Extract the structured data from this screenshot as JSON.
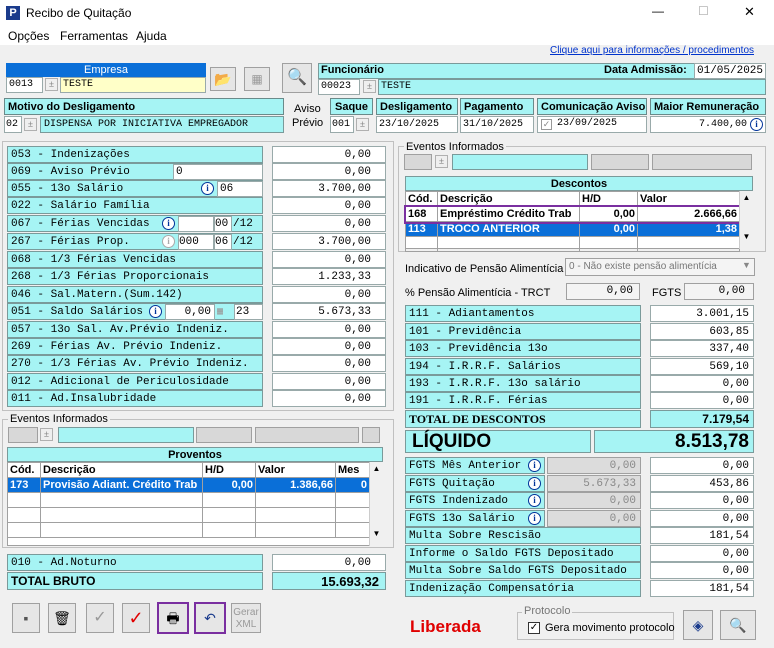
{
  "window": {
    "title": "Recibo de Quitação",
    "minimize": "—",
    "maximize": "☐",
    "close": "✕"
  },
  "menu": [
    "Opções",
    "Ferramentas",
    "Ajuda"
  ],
  "info_link": "Clique aqui para informações / procedimentos",
  "empresa": {
    "label": "Empresa",
    "code": "0013",
    "name": "TESTE"
  },
  "funcionario": {
    "label": "Funcionário",
    "code": "00023",
    "name": "TESTE",
    "admissao_label": "Data Admissão:",
    "admissao": "01/05/2025"
  },
  "motivo": {
    "label": "Motivo do Desligamento",
    "code": "02",
    "text": "DISPENSA POR INICIATIVA EMPREGADOR",
    "aviso_label_1": "Aviso",
    "aviso_label_2": "Prévio"
  },
  "saque": {
    "label": "Saque",
    "value": "001"
  },
  "desligamento": {
    "label": "Desligamento",
    "value": "23/10/2025"
  },
  "pagamento": {
    "label": "Pagamento",
    "value": "31/10/2025"
  },
  "comunicacao": {
    "label": "Comunicação Aviso",
    "value": "23/09/2025"
  },
  "maior": {
    "label": "Maior Remuneração",
    "value": "7.400,00"
  },
  "proventos_rows": [
    {
      "label": "053 - Indenizações",
      "value": "0,00"
    },
    {
      "label": "069 - Aviso Prévio",
      "extra": "0",
      "value": "0,00"
    },
    {
      "label": "055 - 13o Salário",
      "extra": "06",
      "value": "3.700,00"
    },
    {
      "label": "022 - Salário Família",
      "value": "0,00"
    },
    {
      "label": "067 - Férias Vencidas",
      "extra": "00",
      "extra2": "/12",
      "value": "0,00"
    },
    {
      "label": "267 - Férias Prop.",
      "extra": "000",
      "extra2": "06",
      "extra3": "/12",
      "value": "3.700,00"
    },
    {
      "label": "068 - 1/3 Férias Vencidas",
      "value": "0,00"
    },
    {
      "label": "268 - 1/3 Férias Proporcionais",
      "value": "1.233,33"
    },
    {
      "label": "046 - Sal.Matern.(Sum.142)",
      "value": "0,00"
    },
    {
      "label": "051 - Saldo Salários",
      "extra": "0,00",
      "extra2": "23",
      "value": "5.673,33"
    },
    {
      "label": "057 - 13o Sal. Av.Prévio Indeniz.",
      "value": "0,00"
    },
    {
      "label": "269 - Férias Av. Prévio Indeniz.",
      "value": "0,00"
    },
    {
      "label": "270 - 1/3 Férias Av. Prévio Indeniz.",
      "value": "0,00"
    },
    {
      "label": "012 - Adicional de Periculosidade",
      "value": "0,00"
    },
    {
      "label": "011 - Ad.Insalubridade",
      "value": "0,00"
    }
  ],
  "eventos_left": {
    "label": "Eventos Informados",
    "table_title": "Proventos",
    "headers": [
      "Cód.",
      "Descrição",
      "H/D",
      "Valor",
      "Mes"
    ],
    "rows": [
      {
        "cod": "173",
        "desc": "Provisão Adiant. Crédito Trab",
        "hd": "0,00",
        "valor": "1.386,66",
        "mes": "0"
      }
    ]
  },
  "adnoturno": {
    "label": "010 - Ad.Noturno",
    "value": "0,00"
  },
  "total_bruto": {
    "label": "TOTAL BRUTO",
    "value": "15.693,32"
  },
  "eventos_right": {
    "label": "Eventos Informados",
    "table_title": "Descontos",
    "headers": [
      "Cód.",
      "Descrição",
      "H/D",
      "Valor"
    ],
    "rows": [
      {
        "cod": "168",
        "desc": "Empréstimo Crédito Trab",
        "hd": "0,00",
        "valor": "2.666,66"
      },
      {
        "cod": "113",
        "desc": "TROCO ANTERIOR",
        "hd": "0,00",
        "valor": "1,38"
      }
    ]
  },
  "pensao": {
    "label": "Indicativo de Pensão Alimentícia",
    "value": "0 - Não existe pensão alimentícia",
    "pct_label": "% Pensão Alimentícia - TRCT",
    "pct": "0,00",
    "fgts_label": "FGTS",
    "fgts": "0,00"
  },
  "descontos_rows": [
    {
      "label": "111 - Adiantamentos",
      "value": "3.001,15"
    },
    {
      "label": "101 - Previdência",
      "value": "603,85"
    },
    {
      "label": "103 - Previdência 13o",
      "value": "337,40"
    },
    {
      "label": "194 - I.R.R.F. Salários",
      "value": "569,10"
    },
    {
      "label": "193 - I.R.R.F. 13o salário",
      "value": "0,00"
    },
    {
      "label": "191 - I.R.R.F. Férias",
      "value": "0,00"
    }
  ],
  "total_descontos": {
    "label": "TOTAL DE DESCONTOS",
    "value": "7.179,54"
  },
  "liquido": {
    "label": "LÍQUIDO",
    "value": "8.513,78"
  },
  "fgts_rows": [
    {
      "label": "FGTS Mês Anterior",
      "mid": "0,00",
      "value": "0,00"
    },
    {
      "label": "FGTS Quitação",
      "mid": "5.673,33",
      "value": "453,86"
    },
    {
      "label": "FGTS Indenizado",
      "mid": "0,00",
      "value": "0,00"
    },
    {
      "label": "FGTS 13o Salário",
      "mid": "0,00",
      "value": "0,00"
    },
    {
      "label": "Multa Sobre Rescisão",
      "value": "181,54"
    },
    {
      "label": "Informe o Saldo FGTS Depositado",
      "value": "0,00"
    },
    {
      "label": "Multa Sobre Saldo FGTS Depositado",
      "value": "0,00"
    },
    {
      "label": "Indenização Compensatória",
      "value": "181,54"
    }
  ],
  "status": "Liberada",
  "protocolo": {
    "label": "Protocolo",
    "check_label": "Gera movimento protocolo"
  },
  "toolbar": {
    "gerar_1": "Gerar",
    "gerar_2": "XML"
  }
}
